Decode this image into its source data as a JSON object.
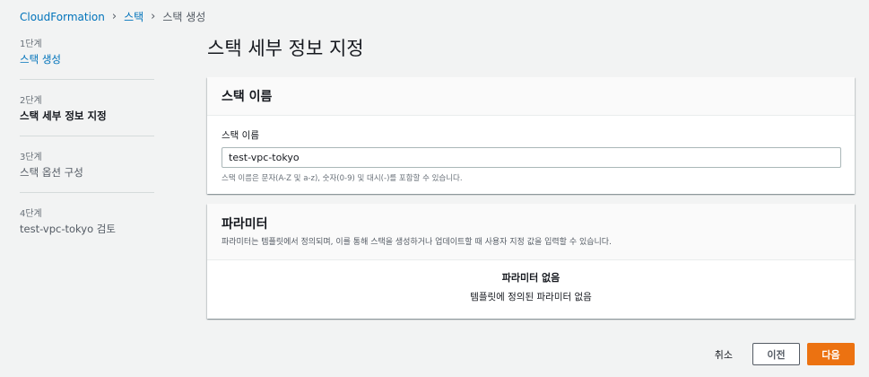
{
  "breadcrumb": {
    "items": [
      "CloudFormation",
      "스택",
      "스택 생성"
    ]
  },
  "steps": [
    {
      "num": "1단계",
      "label": "스택 생성"
    },
    {
      "num": "2단계",
      "label": "스택 세부 정보 지정"
    },
    {
      "num": "3단계",
      "label": "스택 옵션 구성"
    },
    {
      "num": "4단계",
      "label": "test-vpc-tokyo 검토"
    }
  ],
  "page": {
    "title": "스택 세부 정보 지정"
  },
  "stack_name_section": {
    "title": "스택 이름",
    "field_label": "스택 이름",
    "value": "test-vpc-tokyo",
    "hint": "스택 이름은 문자(A-Z 및 a-z), 숫자(0-9) 및 대시(-)를 포함할 수 있습니다."
  },
  "parameters_section": {
    "title": "파라미터",
    "description": "파라미터는 템플릿에서 정의되며, 이를 통해 스택을 생성하거나 업데이트할 때 사용자 지정 값을 입력할 수 있습니다.",
    "empty_title": "파라미터 없음",
    "empty_desc": "템플릿에 정의된 파라미터 없음"
  },
  "actions": {
    "cancel": "취소",
    "previous": "이전",
    "next": "다음"
  },
  "colors": {
    "link": "#0073bb",
    "primary": "#ec7211",
    "background": "#f2f3f3"
  }
}
